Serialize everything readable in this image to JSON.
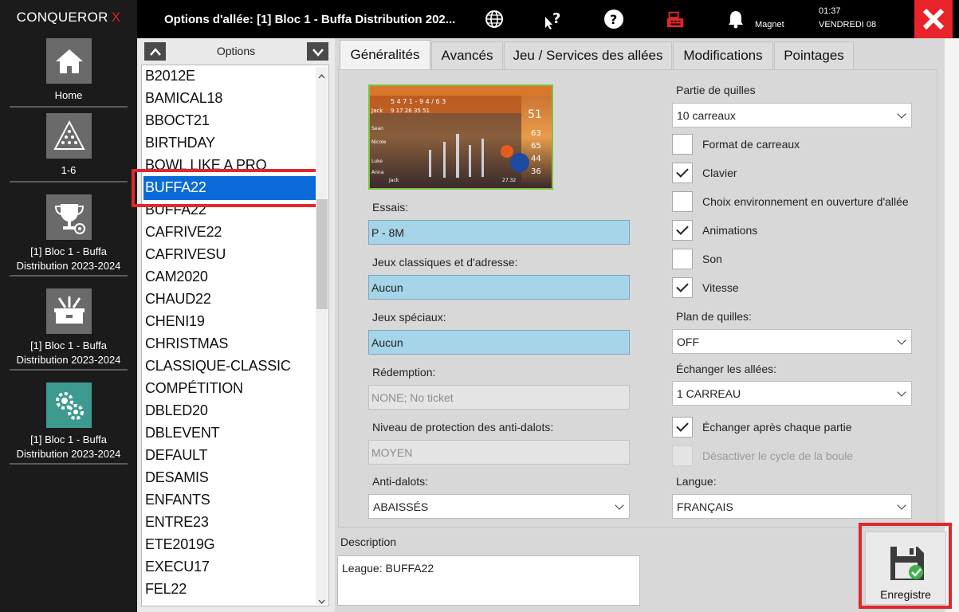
{
  "app": {
    "name": "CONQUEROR",
    "name_suffix": "X"
  },
  "window_title": "Options d'allée: [1] Bloc 1 - Buffa Distribution 202...",
  "topbar": {
    "user": "Magnet",
    "time": "01:37",
    "date": "VENDREDI 08"
  },
  "nav": [
    {
      "label": "Home",
      "icon": "home-icon"
    },
    {
      "label": "1-6",
      "icon": "pins-icon"
    },
    {
      "label": "[1] Bloc 1 - Buffa\nDistribution 2023-2024",
      "icon": "trophy-gear-icon"
    },
    {
      "label": "[1] Bloc 1 - Buffa\nDistribution 2023-2024",
      "icon": "tools-box-icon"
    },
    {
      "label": "[1] Bloc 1 - Buffa\nDistribution 2023-2024",
      "icon": "gears-icon"
    }
  ],
  "options_panel": {
    "header": "Options",
    "items": [
      "B2012E",
      "BAMICAL18",
      "BBOCT21",
      "BIRTHDAY",
      "BOWL LIKE A PRO",
      "BUFFA22",
      "BUFFA22",
      "CAFRIVE22",
      "CAFRIVESU",
      "CAM2020",
      "CHAUD22",
      "CHENI19",
      "CHRISTMAS",
      "CLASSIQUE-CLASSIC",
      "COMPÉTITION",
      "DBLED20",
      "DBLEVENT",
      "DEFAULT",
      "DESAMIS",
      "ENFANTS",
      "ENTRE23",
      "ETE2019G",
      "EXECU17",
      "FEL22"
    ],
    "selected_index": 5
  },
  "tabs": [
    "Généralités",
    "Avancés",
    "Jeu / Services des allées",
    "Modifications",
    "Pointages"
  ],
  "active_tab": 0,
  "preview": {
    "rows": [
      {
        "name": "Jack",
        "score": "51"
      },
      {
        "name": "Sean",
        "score": "63"
      },
      {
        "name": "Nicole",
        "score": "65"
      },
      {
        "name": "Luke",
        "score": "44"
      },
      {
        "name": "Anna",
        "score": "36"
      }
    ],
    "top_line": "5 4 7 1 - 9 4 / 6 3",
    "frames": "9 17 26 35 51",
    "player": "Jack",
    "avg": "27.32"
  },
  "left_fields": {
    "essais": {
      "label": "Essais:",
      "value": "P - 8M"
    },
    "jeux_classiques": {
      "label": "Jeux classiques et d'adresse:",
      "value": "Aucun"
    },
    "jeux_speciaux": {
      "label": "Jeux spéciaux:",
      "value": "Aucun"
    },
    "redemption": {
      "label": "Rédemption:",
      "value": "NONE; No ticket"
    },
    "protection": {
      "label": "Niveau de protection des anti-dalots:",
      "value": "MOYEN"
    },
    "anti_dalots": {
      "label": "Anti-dalots:",
      "value": "ABAISSÉS"
    }
  },
  "right_fields": {
    "partie": {
      "label": "Partie de quilles",
      "value": "10 carreaux"
    },
    "checkboxes": [
      {
        "label": "Format de carreaux",
        "checked": false
      },
      {
        "label": "Clavier",
        "checked": true
      },
      {
        "label": "Choix environnement en ouverture d'allée",
        "checked": false
      },
      {
        "label": "Animations",
        "checked": true
      },
      {
        "label": "Son",
        "checked": false
      },
      {
        "label": "Vitesse",
        "checked": true
      }
    ],
    "plan": {
      "label": "Plan de quilles:",
      "value": "OFF"
    },
    "echanger": {
      "label": "Échanger les allées:",
      "value": "1 CARREAU"
    },
    "echanger_apres": {
      "label": "Échanger après chaque partie",
      "checked": true
    },
    "desactiver": {
      "label": "Désactiver le cycle de la boule",
      "checked": false,
      "disabled": true
    },
    "langue": {
      "label": "Langue:",
      "value": "FRANÇAIS"
    }
  },
  "description": {
    "label": "Description",
    "value": "League: BUFFA22"
  },
  "save": {
    "label": "Enregistre"
  },
  "colors": {
    "accent_red": "#e0282b",
    "selection": "#0a6bd8",
    "field_blue": "#a6d4e8",
    "tile_active": "#3d9a8f"
  }
}
